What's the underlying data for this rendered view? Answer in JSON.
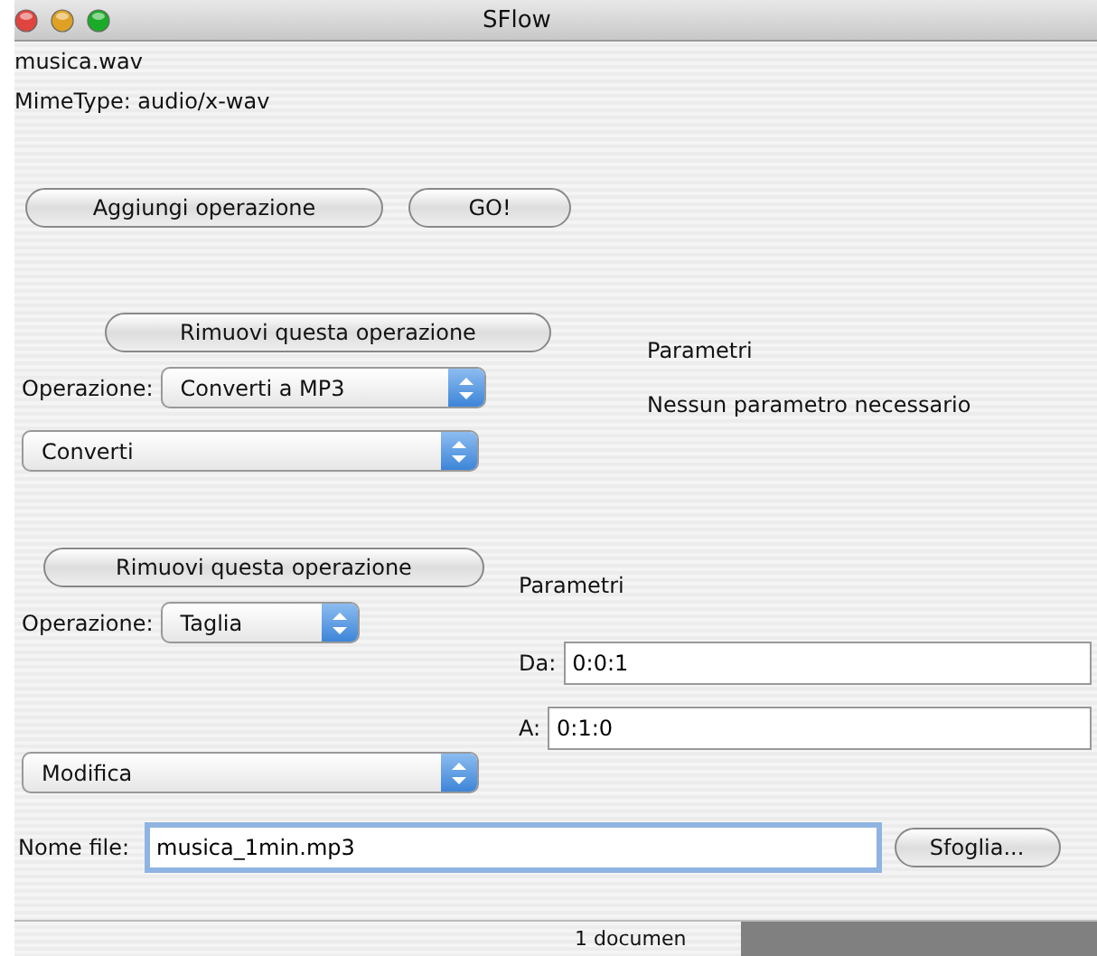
{
  "window": {
    "title": "SFlow"
  },
  "file_name": "musica.wav",
  "mime_type": "MimeType: audio/x-wav",
  "top_buttons": [
    {
      "label": "Aggiungi operazione",
      "kind": "wide"
    },
    {
      "label": "GO!",
      "kind": "narrow"
    }
  ],
  "operations": [
    {
      "kind": "note",
      "remove_button": "Rimuovi questa operazione",
      "operation_label": "Operazione:",
      "operation_value": "Converti a MP3",
      "category_value": "Converti",
      "params_title": "Parametri",
      "params_note": "Nessun parametro necessario"
    },
    {
      "kind": "fields",
      "remove_button": "Rimuovi questa operazione",
      "operation_label": "Operazione:",
      "operation_value": "Taglia",
      "category_value": "Modifica",
      "params_title": "Parametri",
      "params": [
        {
          "label": "Da:",
          "value": "0:0:1"
        },
        {
          "label": "A:",
          "value": "0:1:0"
        }
      ]
    }
  ],
  "output": {
    "label": "Nome file:",
    "value": "musica_1min.mp3",
    "focused": true
  },
  "browse_button": "Sfoglia...",
  "status_bar": {
    "text": "1 documen"
  }
}
